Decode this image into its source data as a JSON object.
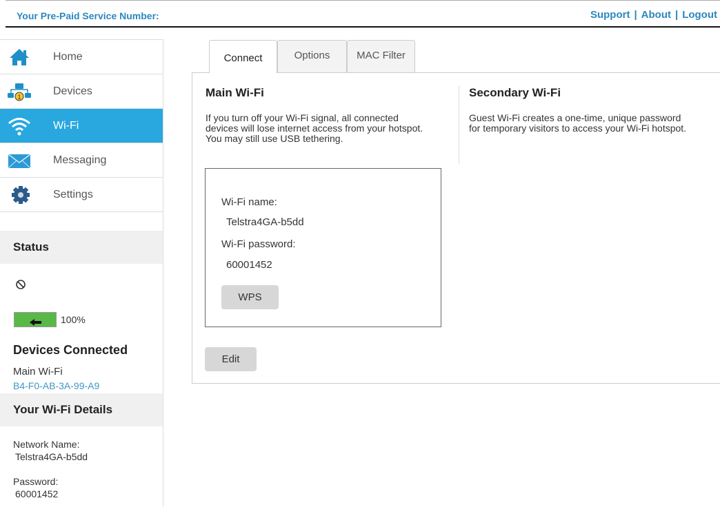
{
  "header": {
    "service_label": "Your Pre-Paid Service Number:",
    "links": [
      "Support",
      "About",
      "Logout"
    ],
    "separator": "|"
  },
  "sidebar": {
    "items": [
      {
        "label": "Home",
        "icon": "home-icon"
      },
      {
        "label": "Devices",
        "icon": "devices-icon"
      },
      {
        "label": "Wi-Fi",
        "icon": "wifi-icon",
        "active": true
      },
      {
        "label": "Messaging",
        "icon": "envelope-icon"
      },
      {
        "label": "Settings",
        "icon": "gear-icon"
      }
    ],
    "status": {
      "title": "Status",
      "battery_percent": "100%",
      "battery_level": 1.0
    },
    "devices_connected": {
      "title": "Devices Connected",
      "network": "Main Wi-Fi",
      "mac": "B4-F0-AB-3A-99-A9"
    },
    "wifi_details": {
      "title": "Your Wi-Fi Details",
      "network_label": "Network Name:",
      "network_value": "Telstra4GA-b5dd",
      "password_label": "Password:",
      "password_value": "60001452"
    }
  },
  "tabs": [
    {
      "label": "Connect",
      "active": true
    },
    {
      "label": "Options"
    },
    {
      "label": "MAC Filter"
    }
  ],
  "main_wifi": {
    "title": "Main Wi-Fi",
    "desc_lines": [
      "If you turn off your Wi-Fi signal, all connected",
      "devices will lose internet access from your hotspot.",
      "You may still use USB tethering."
    ],
    "name_label": "Wi-Fi name:",
    "name_value": "Telstra4GA-b5dd",
    "password_label": "Wi-Fi password:",
    "password_value": "60001452",
    "wps_label": "WPS",
    "edit_label": "Edit"
  },
  "secondary_wifi": {
    "title": "Secondary Wi-Fi",
    "desc_lines": [
      "Guest Wi-Fi creates a one-time, unique password",
      "for temporary visitors to access your Wi-Fi hotspot."
    ]
  },
  "colors": {
    "accent": "#29a8df",
    "link": "#2b87c0",
    "battery": "#58b947"
  }
}
